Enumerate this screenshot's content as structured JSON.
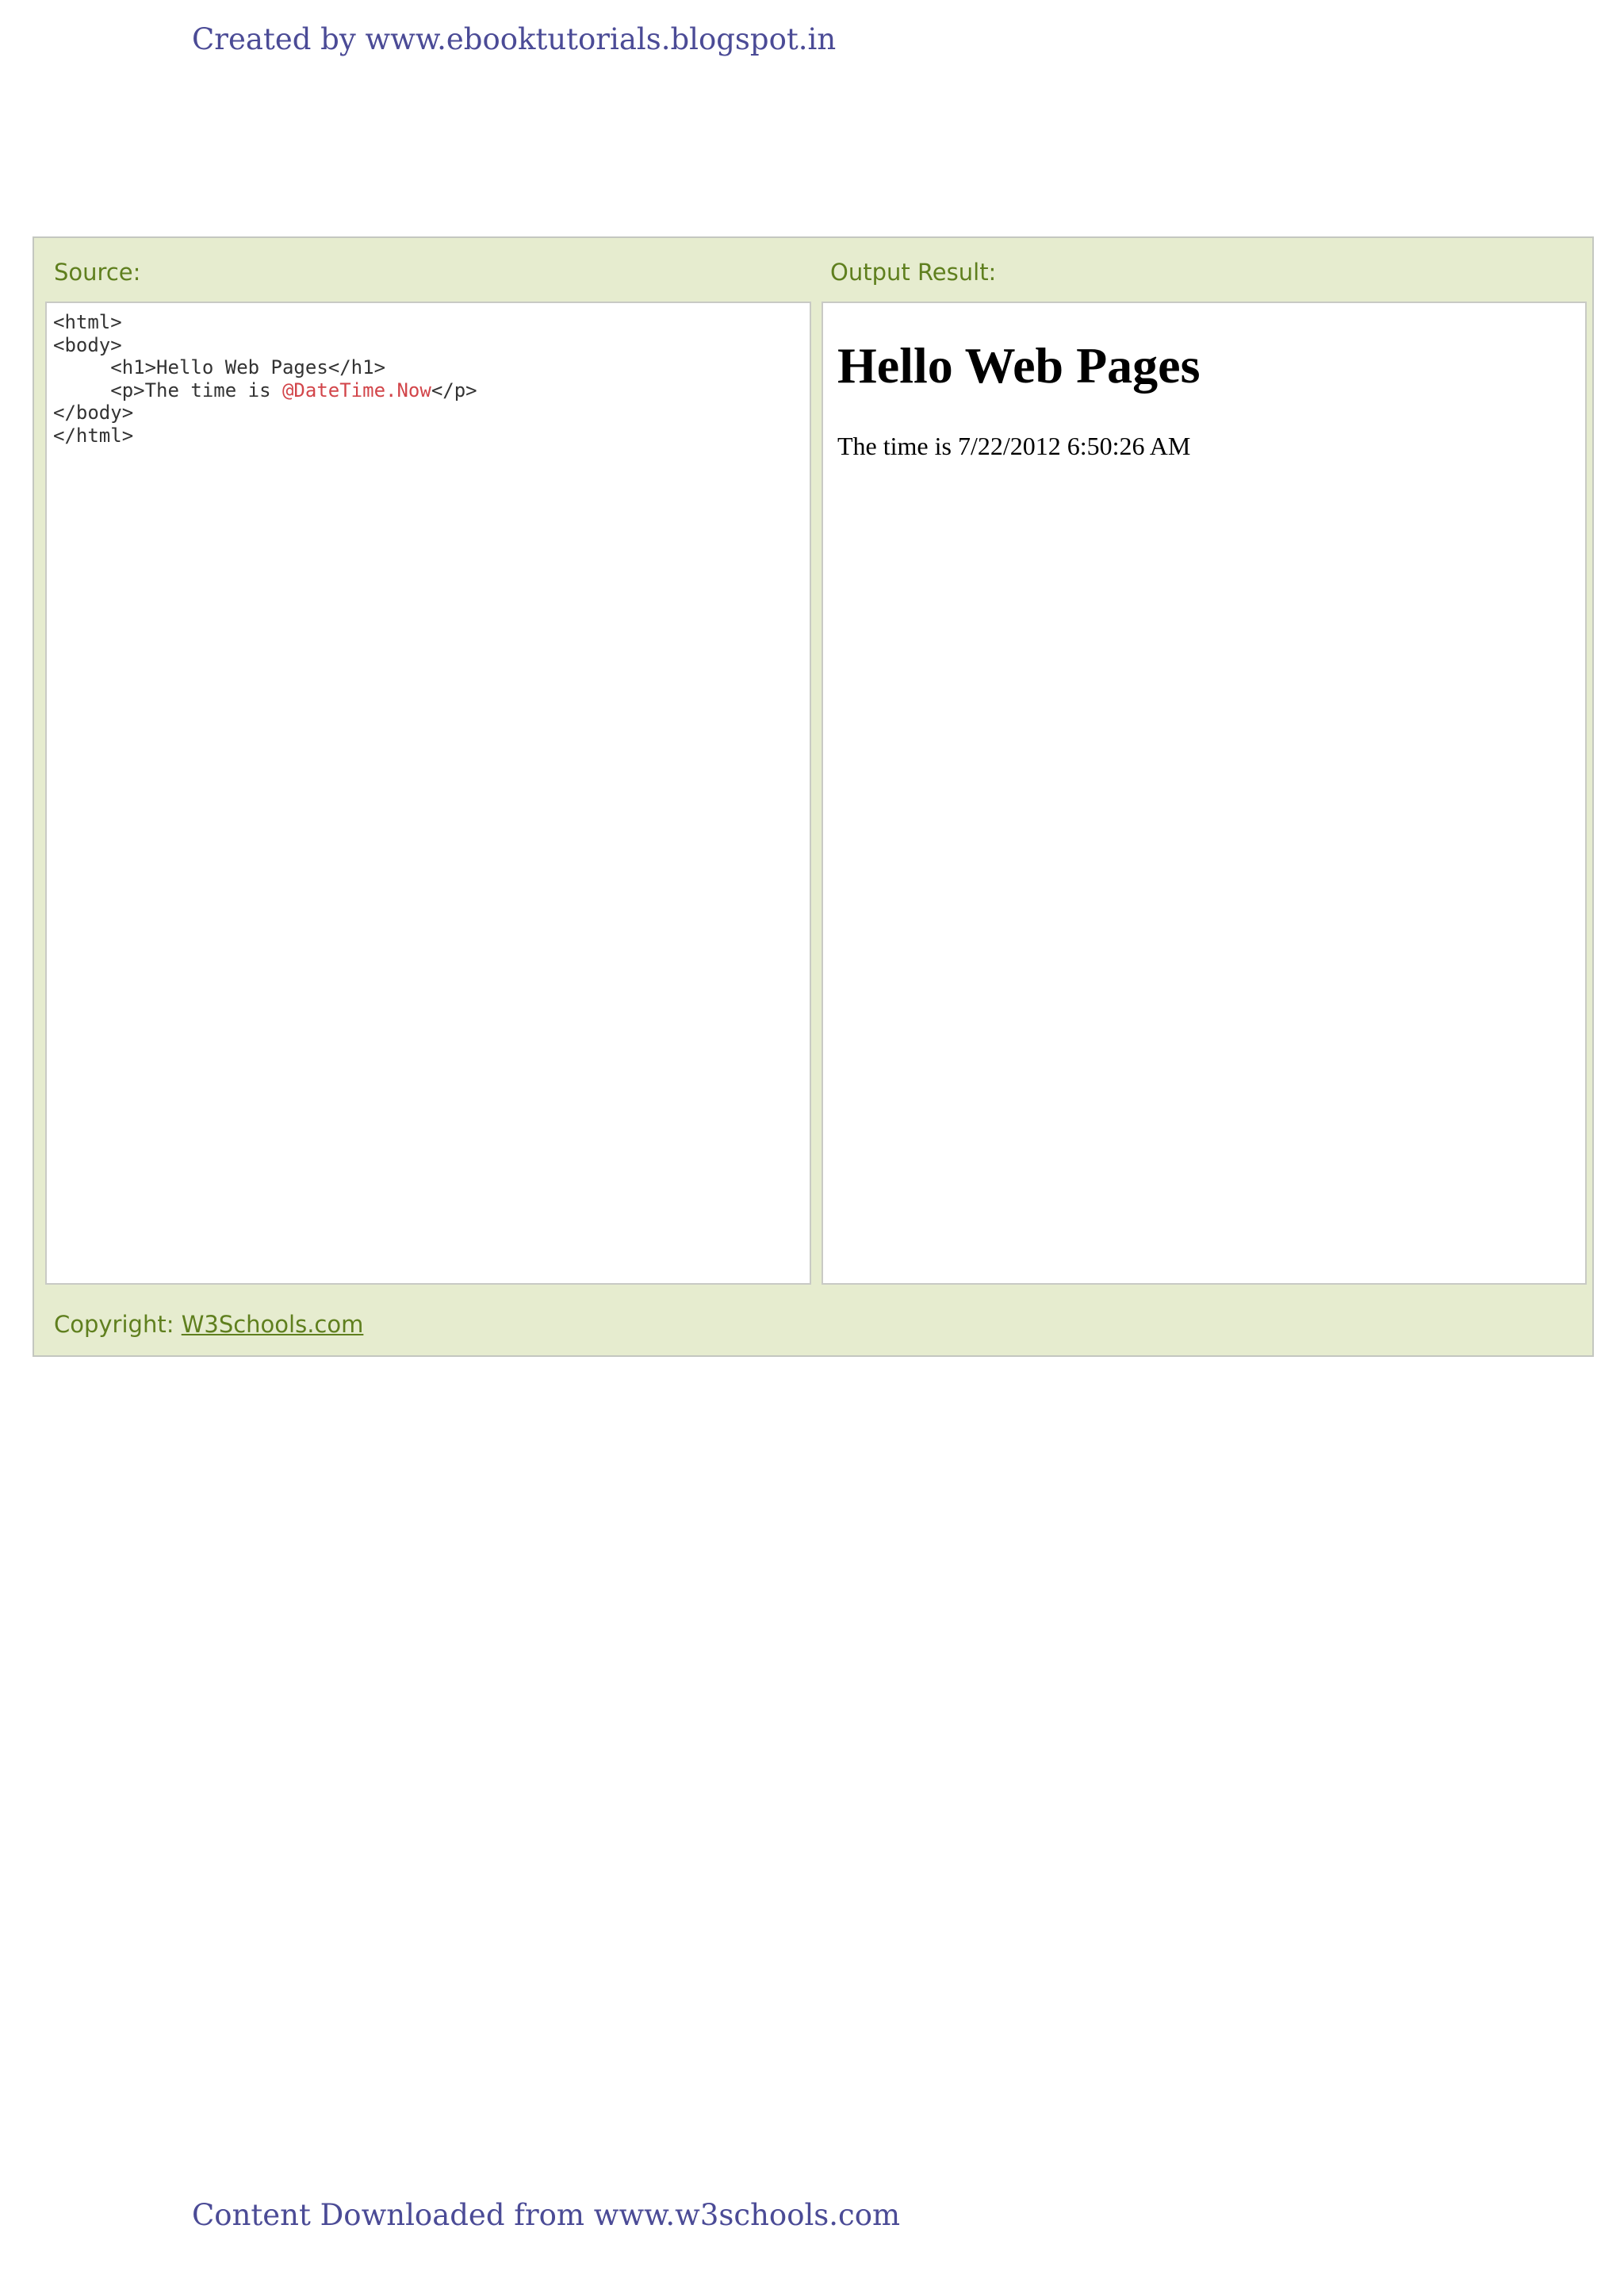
{
  "header": {
    "credit": "Created by www.ebooktutorials.blogspot.in"
  },
  "example": {
    "source_label": "Source:",
    "output_label": "Output Result:",
    "source_code": [
      {
        "before": "<html>",
        "razor": "",
        "after": ""
      },
      {
        "before": "<body>",
        "razor": "",
        "after": ""
      },
      {
        "before": "     <h1>Hello Web Pages</h1>",
        "razor": "",
        "after": ""
      },
      {
        "before": "     <p>The time is ",
        "razor": "@DateTime.Now",
        "after": "</p>"
      },
      {
        "before": "</body>",
        "razor": "",
        "after": ""
      },
      {
        "before": "</html>",
        "razor": "",
        "after": ""
      }
    ],
    "output": {
      "heading": "Hello Web Pages",
      "paragraph": "The time is 7/22/2012 6:50:26 AM"
    },
    "copyright_prefix": "Copyright: ",
    "copyright_link": "W3Schools.com"
  },
  "footer": {
    "credit": "Content Downloaded from www.w3schools.com"
  },
  "colors": {
    "credit_text": "#4b4b96",
    "box_background": "#e6eccf",
    "label_text": "#5f7f1e",
    "razor_highlight": "#d2454a"
  }
}
